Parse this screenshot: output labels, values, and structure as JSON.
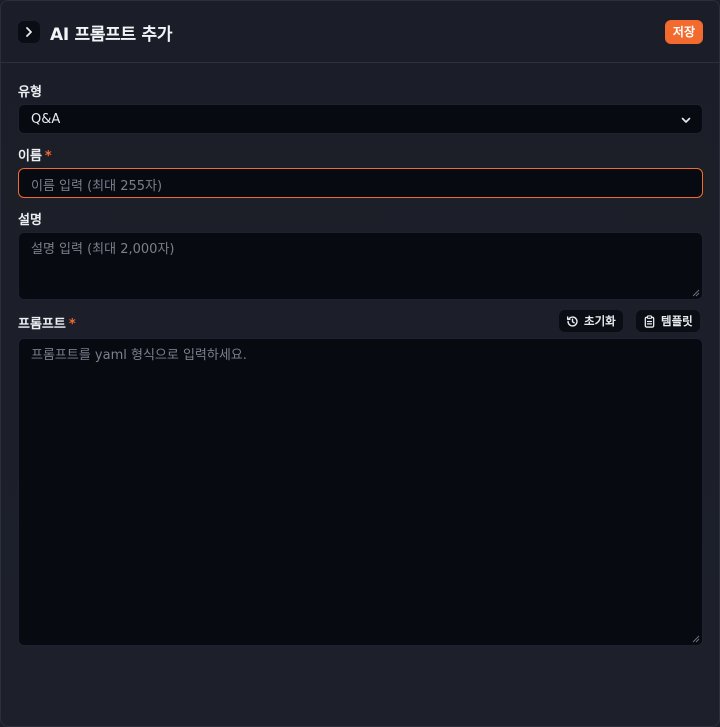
{
  "header": {
    "title": "AI 프롬프트 추가",
    "save_label": "저장",
    "collapse_icon": "chevron-right-icon"
  },
  "form": {
    "type": {
      "label": "유형",
      "value": "Q&A"
    },
    "name": {
      "label": "이름",
      "required_mark": "*",
      "placeholder": "이름 입력 (최대 255자)"
    },
    "description": {
      "label": "설명",
      "placeholder": "설명 입력 (최대 2,000자)"
    },
    "prompt": {
      "label": "프롬프트",
      "required_mark": "*",
      "placeholder": "프롬프트를 yaml 형식으로 입력하세요.",
      "reset_label": "초기화",
      "template_label": "템플릿"
    }
  },
  "colors": {
    "accent": "#f26a2d",
    "background": "#1c1f29",
    "field_background": "#080a11"
  }
}
